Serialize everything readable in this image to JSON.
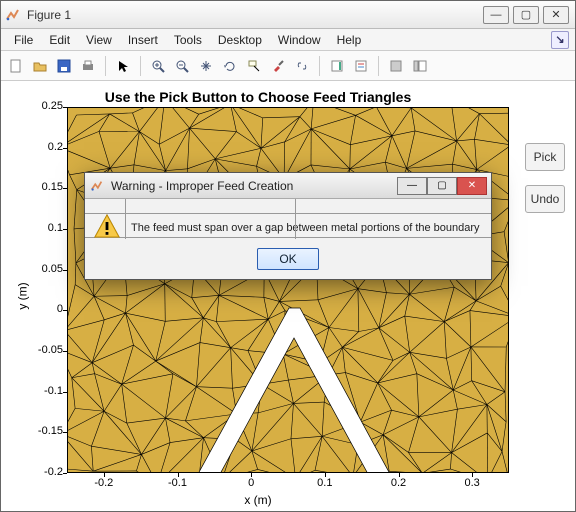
{
  "window": {
    "title": "Figure 1",
    "controls": {
      "min": "—",
      "max": "▢",
      "close": "✕"
    }
  },
  "menu": {
    "file": "File",
    "edit": "Edit",
    "view": "View",
    "insert": "Insert",
    "tools": "Tools",
    "desktop": "Desktop",
    "window": "Window",
    "help": "Help",
    "help_icon": "↘"
  },
  "toolbar": {
    "new": "🗋",
    "open": "📂",
    "save": "💾",
    "print": "🖶",
    "pointer": "↖",
    "zoomin": "🔍₊",
    "zoomout": "🔍₋",
    "pan": "✋",
    "rotate": "⟳",
    "datacursor": "⬚",
    "brush": "🖌",
    "link": "⎘",
    "colorbar": "▯",
    "legend": "☰",
    "axes1": "◧",
    "axes2": "◨"
  },
  "plot": {
    "title": "Use the Pick Button to Choose Feed Triangles",
    "xlabel": "x (m)",
    "ylabel": "y (m)",
    "xticks": [
      "-0.2",
      "-0.1",
      "0",
      "0.1",
      "0.2",
      "0.3"
    ],
    "yticks": [
      "0.25",
      "0.2",
      "0.15",
      "0.1",
      "0.05",
      "0",
      "-0.05",
      "-0.1",
      "-0.15",
      "-0.2"
    ]
  },
  "side": {
    "pick": "Pick",
    "undo": "Undo"
  },
  "dialog": {
    "title": "Warning - Improper Feed Creation",
    "message": "The feed must span over a gap between metal portions of the boundary",
    "ok": "OK",
    "controls": {
      "min": "—",
      "max": "▢",
      "close": "✕"
    }
  },
  "chart_data": {
    "type": "scatter",
    "title": "Use the Pick Button to Choose Feed Triangles",
    "xlabel": "x (m)",
    "ylabel": "y (m)",
    "xlim": [
      -0.25,
      0.35
    ],
    "ylim": [
      -0.2,
      0.25
    ],
    "series": [
      {
        "name": "triangular-mesh",
        "note": "Dense triangulated mesh fill over axes; nodes not individually readable",
        "values": []
      },
      {
        "name": "v-notch-gap",
        "note": "White V-shaped gap centered near (0, -0.05) extending to (-0.15,-0.20) and (0.15,-0.20)",
        "values": []
      }
    ]
  }
}
